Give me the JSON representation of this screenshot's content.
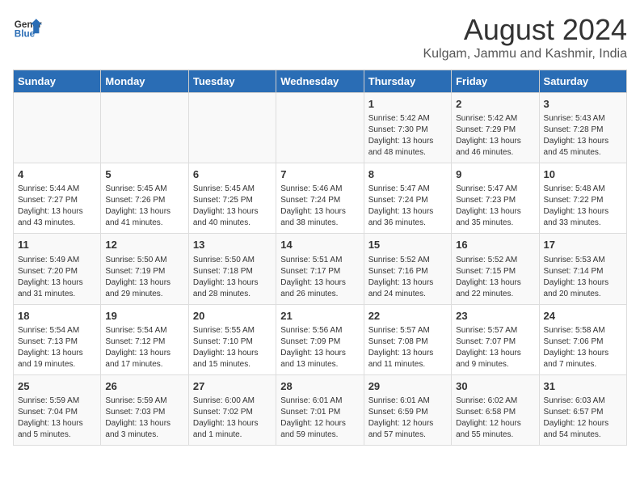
{
  "header": {
    "logo_line1": "General",
    "logo_line2": "Blue",
    "title": "August 2024",
    "subtitle": "Kulgam, Jammu and Kashmir, India"
  },
  "days_of_week": [
    "Sunday",
    "Monday",
    "Tuesday",
    "Wednesday",
    "Thursday",
    "Friday",
    "Saturday"
  ],
  "weeks": [
    [
      {
        "day": "",
        "info": ""
      },
      {
        "day": "",
        "info": ""
      },
      {
        "day": "",
        "info": ""
      },
      {
        "day": "",
        "info": ""
      },
      {
        "day": "1",
        "info": "Sunrise: 5:42 AM\nSunset: 7:30 PM\nDaylight: 13 hours\nand 48 minutes."
      },
      {
        "day": "2",
        "info": "Sunrise: 5:42 AM\nSunset: 7:29 PM\nDaylight: 13 hours\nand 46 minutes."
      },
      {
        "day": "3",
        "info": "Sunrise: 5:43 AM\nSunset: 7:28 PM\nDaylight: 13 hours\nand 45 minutes."
      }
    ],
    [
      {
        "day": "4",
        "info": "Sunrise: 5:44 AM\nSunset: 7:27 PM\nDaylight: 13 hours\nand 43 minutes."
      },
      {
        "day": "5",
        "info": "Sunrise: 5:45 AM\nSunset: 7:26 PM\nDaylight: 13 hours\nand 41 minutes."
      },
      {
        "day": "6",
        "info": "Sunrise: 5:45 AM\nSunset: 7:25 PM\nDaylight: 13 hours\nand 40 minutes."
      },
      {
        "day": "7",
        "info": "Sunrise: 5:46 AM\nSunset: 7:24 PM\nDaylight: 13 hours\nand 38 minutes."
      },
      {
        "day": "8",
        "info": "Sunrise: 5:47 AM\nSunset: 7:24 PM\nDaylight: 13 hours\nand 36 minutes."
      },
      {
        "day": "9",
        "info": "Sunrise: 5:47 AM\nSunset: 7:23 PM\nDaylight: 13 hours\nand 35 minutes."
      },
      {
        "day": "10",
        "info": "Sunrise: 5:48 AM\nSunset: 7:22 PM\nDaylight: 13 hours\nand 33 minutes."
      }
    ],
    [
      {
        "day": "11",
        "info": "Sunrise: 5:49 AM\nSunset: 7:20 PM\nDaylight: 13 hours\nand 31 minutes."
      },
      {
        "day": "12",
        "info": "Sunrise: 5:50 AM\nSunset: 7:19 PM\nDaylight: 13 hours\nand 29 minutes."
      },
      {
        "day": "13",
        "info": "Sunrise: 5:50 AM\nSunset: 7:18 PM\nDaylight: 13 hours\nand 28 minutes."
      },
      {
        "day": "14",
        "info": "Sunrise: 5:51 AM\nSunset: 7:17 PM\nDaylight: 13 hours\nand 26 minutes."
      },
      {
        "day": "15",
        "info": "Sunrise: 5:52 AM\nSunset: 7:16 PM\nDaylight: 13 hours\nand 24 minutes."
      },
      {
        "day": "16",
        "info": "Sunrise: 5:52 AM\nSunset: 7:15 PM\nDaylight: 13 hours\nand 22 minutes."
      },
      {
        "day": "17",
        "info": "Sunrise: 5:53 AM\nSunset: 7:14 PM\nDaylight: 13 hours\nand 20 minutes."
      }
    ],
    [
      {
        "day": "18",
        "info": "Sunrise: 5:54 AM\nSunset: 7:13 PM\nDaylight: 13 hours\nand 19 minutes."
      },
      {
        "day": "19",
        "info": "Sunrise: 5:54 AM\nSunset: 7:12 PM\nDaylight: 13 hours\nand 17 minutes."
      },
      {
        "day": "20",
        "info": "Sunrise: 5:55 AM\nSunset: 7:10 PM\nDaylight: 13 hours\nand 15 minutes."
      },
      {
        "day": "21",
        "info": "Sunrise: 5:56 AM\nSunset: 7:09 PM\nDaylight: 13 hours\nand 13 minutes."
      },
      {
        "day": "22",
        "info": "Sunrise: 5:57 AM\nSunset: 7:08 PM\nDaylight: 13 hours\nand 11 minutes."
      },
      {
        "day": "23",
        "info": "Sunrise: 5:57 AM\nSunset: 7:07 PM\nDaylight: 13 hours\nand 9 minutes."
      },
      {
        "day": "24",
        "info": "Sunrise: 5:58 AM\nSunset: 7:06 PM\nDaylight: 13 hours\nand 7 minutes."
      }
    ],
    [
      {
        "day": "25",
        "info": "Sunrise: 5:59 AM\nSunset: 7:04 PM\nDaylight: 13 hours\nand 5 minutes."
      },
      {
        "day": "26",
        "info": "Sunrise: 5:59 AM\nSunset: 7:03 PM\nDaylight: 13 hours\nand 3 minutes."
      },
      {
        "day": "27",
        "info": "Sunrise: 6:00 AM\nSunset: 7:02 PM\nDaylight: 13 hours\nand 1 minute."
      },
      {
        "day": "28",
        "info": "Sunrise: 6:01 AM\nSunset: 7:01 PM\nDaylight: 12 hours\nand 59 minutes."
      },
      {
        "day": "29",
        "info": "Sunrise: 6:01 AM\nSunset: 6:59 PM\nDaylight: 12 hours\nand 57 minutes."
      },
      {
        "day": "30",
        "info": "Sunrise: 6:02 AM\nSunset: 6:58 PM\nDaylight: 12 hours\nand 55 minutes."
      },
      {
        "day": "31",
        "info": "Sunrise: 6:03 AM\nSunset: 6:57 PM\nDaylight: 12 hours\nand 54 minutes."
      }
    ]
  ]
}
